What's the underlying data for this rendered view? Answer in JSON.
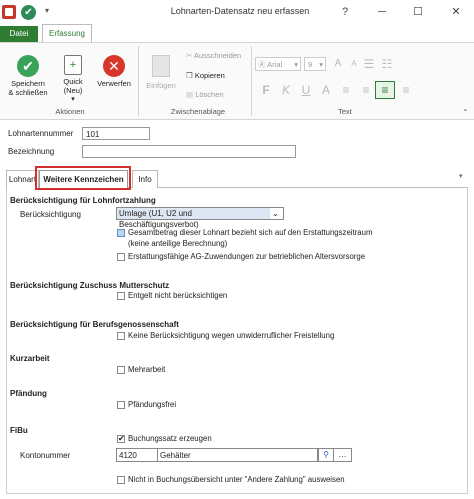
{
  "titlebar": {
    "title": "Lohnarten-Datensatz neu erfassen",
    "help": "?",
    "minimize": "─",
    "maximize": "☐",
    "close": "✕"
  },
  "tabs": {
    "datei": "Datei",
    "erfassung": "Erfassung"
  },
  "ribbon": {
    "aktionen": {
      "label": "Aktionen",
      "save": [
        "Speichern",
        "& schließen"
      ],
      "quick": [
        "Quick",
        "(Neu)"
      ],
      "discard": "Verwerfen"
    },
    "zwischenablage": {
      "label": "Zwischenablage",
      "paste": "Einfügen",
      "cut": "Ausschneiden",
      "copy": "Kopieren",
      "delete": "Löschen"
    },
    "text": {
      "label": "Text",
      "font": "Arial",
      "size": "9"
    }
  },
  "form": {
    "lohnartennummer_label": "Lohnartennummer",
    "lohnartennummer_value": "101",
    "bezeichnung_label": "Bezeichnung",
    "bezeichnung_value": ""
  },
  "formtabs": {
    "lohnart": "Lohnart",
    "weitere": "Weitere Kennzeichen",
    "info": "Info"
  },
  "sections": {
    "lohnfortzahlung": {
      "title": "Berücksichtigung für Lohnfortzahlung",
      "field_label": "Berücksichtigung",
      "select_value": "Umlage (U1, U2 und Beschäftigungsverbot)",
      "cb1_line1": "Gesamtbetrag dieser Lohnart bezieht sich auf den Erstattungszeitraum",
      "cb1_line2": "(keine anteilige Berechnung)",
      "cb2": "Erstattungsfähige AG-Zuwendungen zur betrieblichen Altersvorsorge"
    },
    "mutterschutz": {
      "title": "Berücksichtigung Zuschuss Mutterschutz",
      "cb": "Entgelt nicht berücksichtigen"
    },
    "berufsgenossenschaft": {
      "title": "Berücksichtigung für Berufsgenossenschaft",
      "cb": "Keine Berücksichtigung wegen unwiderruflicher Freistellung"
    },
    "kurzarbeit": {
      "title": "Kurzarbeit",
      "cb": "Mehrarbeit"
    },
    "pfaendung": {
      "title": "Pfändung",
      "cb": "Pfändungsfrei"
    },
    "fibu": {
      "title": "FiBu",
      "cb_buchungssatz": "Buchungssatz erzeugen",
      "kontonummer_label": "Kontonummer",
      "kontonummer_value": "4120",
      "konto_name": "Gehälter",
      "cb_nicht": "Nicht in Buchungsübersicht unter \"Andere Zahlung\" ausweisen"
    }
  }
}
